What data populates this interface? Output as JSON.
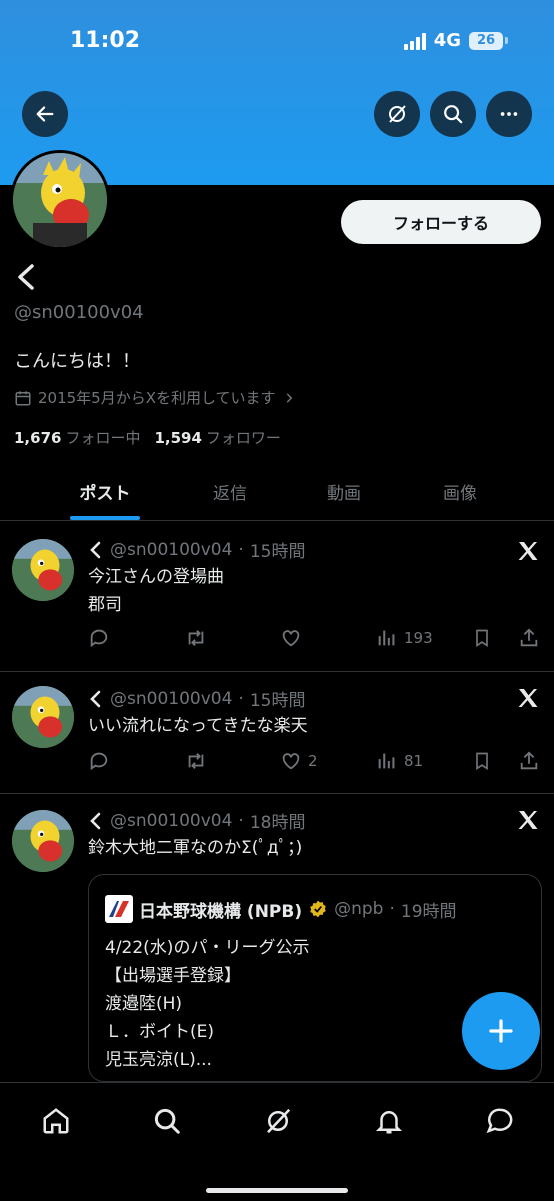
{
  "status_bar": {
    "time": "11:02",
    "network": "4G",
    "battery": "26"
  },
  "header": {
    "back_icon": "arrow-left-icon",
    "icons": [
      "grok-icon",
      "search-icon",
      "more-icon"
    ]
  },
  "profile": {
    "follow_label": "フォローする",
    "handle": "@sn00100v04",
    "bio": "こんにちは！！",
    "joined": "2015年5月からXを利用しています",
    "following_count": "1,676",
    "following_label": "フォロー中",
    "followers_count": "1,594",
    "followers_label": "フォロワー"
  },
  "tabs": [
    {
      "label": "ポスト",
      "active": true
    },
    {
      "label": "返信",
      "active": false
    },
    {
      "label": "動画",
      "active": false
    },
    {
      "label": "画像",
      "active": false
    }
  ],
  "posts": [
    {
      "handle": "@sn00100v04",
      "time": "15時間",
      "lines": [
        "今江さんの登場曲",
        "郡司"
      ],
      "likes": "",
      "views": "193"
    },
    {
      "handle": "@sn00100v04",
      "time": "15時間",
      "lines": [
        "いい流れになってきたな楽天"
      ],
      "likes": "2",
      "views": "81"
    },
    {
      "handle": "@sn00100v04",
      "time": "18時間",
      "lines": [
        "鈴木大地二軍なのかΣ(ﾟдﾟ；)"
      ]
    }
  ],
  "separator": "·",
  "quote": {
    "name": "日本野球機構 (NPB)",
    "handle": "@npb",
    "time": "19時間",
    "lines": [
      "4/22(水)のパ・リーグ公示",
      "【出場選手登録】",
      "渡邉陸(H)",
      "Ｌ．ボイト(E)",
      "児玉亮涼(L)..."
    ]
  },
  "colors": {
    "accent": "#1d9bf0",
    "banner": "#2f8fde",
    "muted": "#71767b",
    "background": "#000000"
  }
}
